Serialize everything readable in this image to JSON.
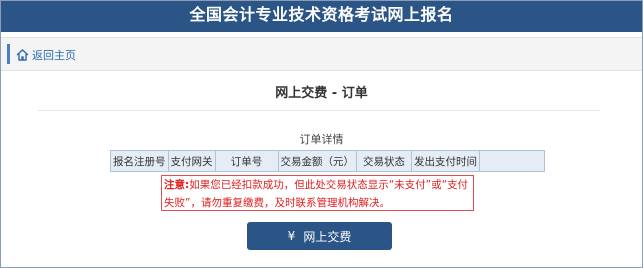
{
  "header": {
    "title": "全国会计专业技术资格考试网上报名"
  },
  "toolbar": {
    "home_label": "返回主页"
  },
  "page": {
    "title": "网上交费 - 订单"
  },
  "order": {
    "section_title": "订单详情",
    "columns": [
      "报名注册号",
      "支付网关",
      "订单号",
      "交易金额（元）",
      "交易状态",
      "发出支付时间",
      ""
    ]
  },
  "notice": {
    "label": "注意:",
    "text": "如果您已经扣款成功，但此处交易状态显示“未支付”或“支付失败”，请勿重复缴费，及时联系管理机构解决。"
  },
  "pay_button": {
    "icon": "¥",
    "label": "网上交费"
  },
  "colors": {
    "brand": "#2a5586",
    "link": "#2d6ab3",
    "warning": "#e02020"
  }
}
